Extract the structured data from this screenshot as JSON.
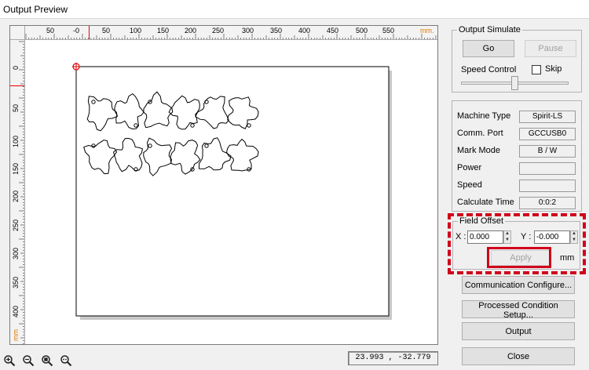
{
  "window": {
    "title": "Output Preview"
  },
  "ruler": {
    "unit": "mm.",
    "top_labels": [
      "50",
      "-0",
      "50",
      "100",
      "150",
      "200",
      "250",
      "300",
      "350",
      "400",
      "450",
      "500",
      "550"
    ],
    "left_labels": [
      "0",
      "50",
      "100",
      "150",
      "200",
      "250",
      "300",
      "350",
      "400"
    ],
    "left_unit": "mm"
  },
  "coordinates": {
    "readout": "23.993 , -32.779"
  },
  "zoom_tools": [
    {
      "name": "zoom-in-icon"
    },
    {
      "name": "zoom-out-icon"
    },
    {
      "name": "zoom-fit-icon"
    },
    {
      "name": "zoom-actual-icon"
    }
  ],
  "output_simulate": {
    "title": "Output  Simulate",
    "go_label": "Go",
    "pause_label": "Pause",
    "speed_label": "Speed Control",
    "skip_label": "Skip",
    "skip_checked": false,
    "speed_level": 0.5
  },
  "machine_info": [
    {
      "label": "Machine Type",
      "value": "Spirit-LS"
    },
    {
      "label": "Comm. Port",
      "value": "GCCUSB0"
    },
    {
      "label": "Mark Mode",
      "value": "B / W"
    },
    {
      "label": "Power",
      "value": ""
    },
    {
      "label": "Speed",
      "value": ""
    },
    {
      "label": "Calculate Time",
      "value": "0:0:2"
    }
  ],
  "field_offset": {
    "title": "Field Offset",
    "x_label": "X :",
    "x_value": "0.000",
    "y_label": "Y :",
    "y_value": "-0.000",
    "apply_label": "Apply",
    "unit": "mm"
  },
  "buttons": {
    "communication": "Communication Configure...",
    "processed": "Processed Condition Setup...",
    "output": "Output",
    "close": "Close"
  },
  "colors": {
    "highlight": "#d0021b",
    "ruler_marker": "#e00000",
    "unit_label": "#e07a00"
  }
}
